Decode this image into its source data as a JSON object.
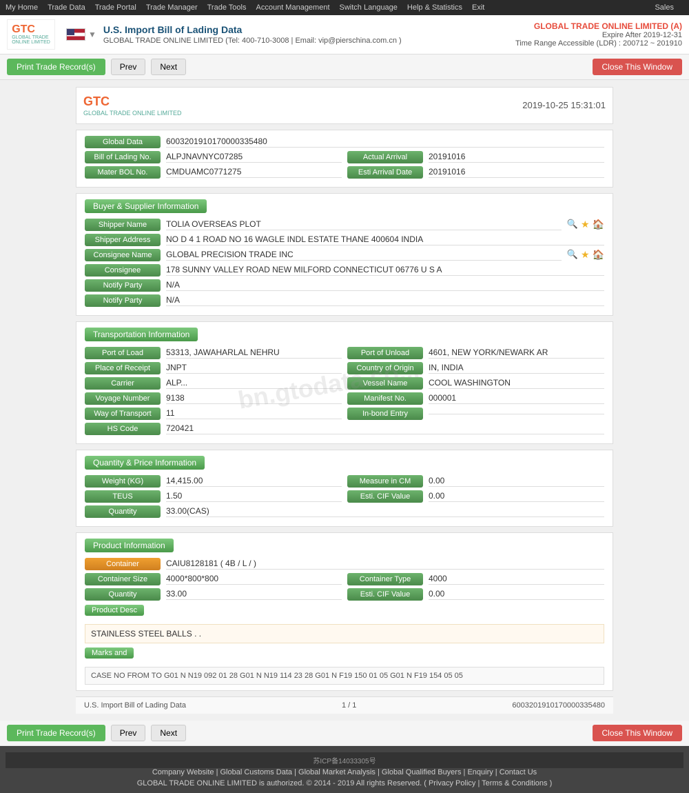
{
  "nav": {
    "items": [
      "My Home",
      "Trade Data",
      "Trade Portal",
      "Trade Manager",
      "Trade Tools",
      "Account Management",
      "Switch Language",
      "Help & Statistics",
      "Exit",
      "Sales"
    ]
  },
  "header": {
    "logo_text": "GTC",
    "logo_subtext": "GLOBAL TRADE ONLINE LIMITED",
    "flag_label": "US Flag",
    "title": "U.S. Import Bill of Lading Data",
    "subtitle": "GLOBAL TRADE ONLINE LIMITED  (Tel: 400-710-3008 | Email: vip@pierschina.com.cn )",
    "company": "GLOBAL TRADE ONLINE LIMITED (A)",
    "expire": "Expire After 2019-12-31",
    "time_range": "Time Range Accessible (LDR) : 200712 ~ 201910"
  },
  "toolbar": {
    "print_label": "Print Trade Record(s)",
    "prev_label": "Prev",
    "next_label": "Next",
    "close_label": "Close This Window"
  },
  "record": {
    "datetime": "2019-10-25 15:31:01",
    "global_data_label": "Global Data",
    "global_data_value": "6003201910170000335480",
    "bill_of_lading_label": "Bill of Lading No.",
    "bill_of_lading_value": "ALPJNAVNYC07285",
    "actual_arrival_label": "Actual Arrival",
    "actual_arrival_value": "20191016",
    "mater_bol_label": "Mater BOL No.",
    "mater_bol_value": "CMDUAMC0771275",
    "esti_arrival_label": "Esti Arrival Date",
    "esti_arrival_value": "20191016"
  },
  "buyer_supplier": {
    "section_title": "Buyer & Supplier Information",
    "shipper_name_label": "Shipper Name",
    "shipper_name_value": "TOLIA OVERSEAS PLOT",
    "shipper_address_label": "Shipper Address",
    "shipper_address_value": "NO D 4 1 ROAD NO 16 WAGLE INDL ESTATE THANE 400604 INDIA",
    "consignee_name_label": "Consignee Name",
    "consignee_name_value": "GLOBAL PRECISION TRADE INC",
    "consignee_label": "Consignee",
    "consignee_value": "178 SUNNY VALLEY ROAD NEW MILFORD CONNECTICUT 06776 U S A",
    "notify_party1_label": "Notify Party",
    "notify_party1_value": "N/A",
    "notify_party2_label": "Notify Party",
    "notify_party2_value": "N/A"
  },
  "transportation": {
    "section_title": "Transportation Information",
    "port_of_load_label": "Port of Load",
    "port_of_load_value": "53313, JAWAHARLAL NEHRU",
    "port_of_unload_label": "Port of Unload",
    "port_of_unload_value": "4601, NEW YORK/NEWARK AR",
    "place_of_receipt_label": "Place of Receipt",
    "place_of_receipt_value": "JNPT",
    "country_of_origin_label": "Country of Origin",
    "country_of_origin_value": "IN, INDIA",
    "carrier_label": "Carrier",
    "carrier_value": "ALP...",
    "vessel_name_label": "Vessel Name",
    "vessel_name_value": "COOL WASHINGTON",
    "voyage_number_label": "Voyage Number",
    "voyage_number_value": "9138",
    "manifest_no_label": "Manifest No.",
    "manifest_no_value": "000001",
    "way_of_transport_label": "Way of Transport",
    "way_of_transport_value": "11",
    "in_bond_entry_label": "In-bond Entry",
    "in_bond_entry_value": "",
    "hs_code_label": "HS Code",
    "hs_code_value": "720421"
  },
  "quantity_price": {
    "section_title": "Quantity & Price Information",
    "weight_label": "Weight (KG)",
    "weight_value": "14,415.00",
    "measure_cm_label": "Measure in CM",
    "measure_cm_value": "0.00",
    "teus_label": "TEUS",
    "teus_value": "1.50",
    "esti_cif_label": "Esti. CIF Value",
    "esti_cif_value": "0.00",
    "quantity_label": "Quantity",
    "quantity_value": "33.00(CAS)"
  },
  "product_info": {
    "section_title": "Product Information",
    "container_label": "Container",
    "container_value": "CAIU8128181 ( 4B / L / )",
    "container_size_label": "Container Size",
    "container_size_value": "4000*800*800",
    "container_type_label": "Container Type",
    "container_type_value": "4000",
    "quantity_label": "Quantity",
    "quantity_value": "33.00",
    "esti_cif_label": "Esti. CIF Value",
    "esti_cif_value": "0.00",
    "product_desc_label": "Product Desc",
    "product_desc_value": "STAINLESS STEEL BALLS . .",
    "marks_label": "Marks and",
    "marks_value": "CASE NO FROM TO G01 N N19 092 01 28 G01 N N19 114 23 28 G01 N F19 150 01 05 G01 N F19 154 05 05"
  },
  "pagination": {
    "page_label": "U.S. Import Bill of Lading Data",
    "page_info": "1 / 1",
    "record_id": "6003201910170000335480"
  },
  "footer": {
    "icp": "苏ICP备14033305号",
    "links": [
      "Company Website",
      "Global Customs Data",
      "Global Market Analysis",
      "Global Qualified Buyers",
      "Enquiry",
      "Contact Us"
    ],
    "copyright": "GLOBAL TRADE ONLINE LIMITED is authorized. © 2014 - 2019 All rights Reserved.  ( Privacy Policy | Terms & Conditions )"
  },
  "watermark": "bn.gtodata.co..."
}
